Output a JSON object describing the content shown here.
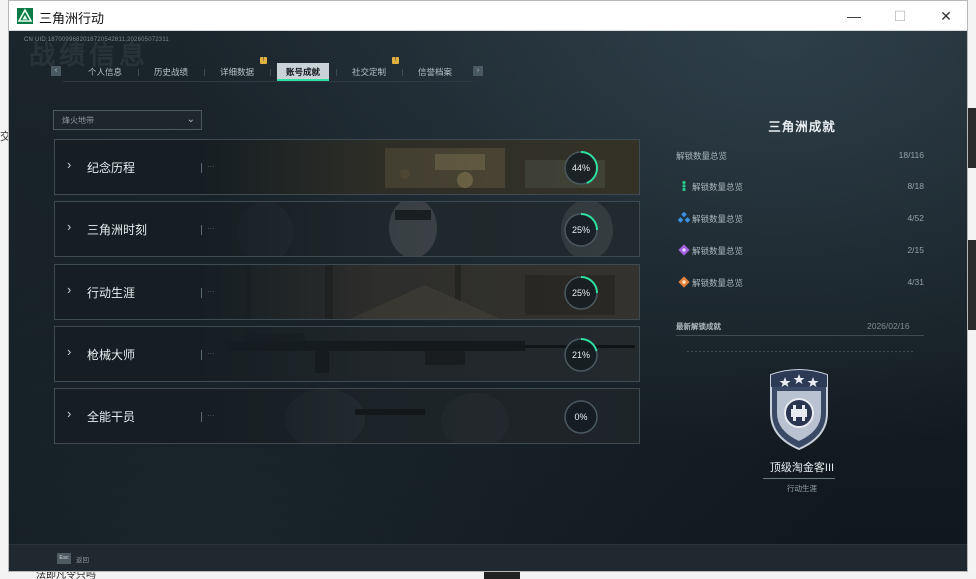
{
  "window": {
    "title": "三角洲行动",
    "controls": {
      "minimize": "—",
      "maximize": "☐",
      "close": "✕"
    }
  },
  "header": {
    "uid_line": "CN UID:1870099682018720542811,202605072311",
    "watermark": "战绩信息"
  },
  "nav": {
    "prev_arrow": "‹",
    "next_arrow": "›",
    "tabs": [
      {
        "label": "个人信息",
        "active": false,
        "badge": ""
      },
      {
        "label": "历史战绩",
        "active": false,
        "badge": ""
      },
      {
        "label": "详细数据",
        "active": false,
        "badge": "!"
      },
      {
        "label": "账号成就",
        "active": true,
        "badge": ""
      },
      {
        "label": "社交定制",
        "active": false,
        "badge": "!"
      },
      {
        "label": "信誉档案",
        "active": false,
        "badge": ""
      }
    ]
  },
  "filter": {
    "value": "烽火地带"
  },
  "categories": [
    {
      "label": "纪念历程",
      "progress": 44,
      "progress_text": "44%"
    },
    {
      "label": "三角洲时刻",
      "progress": 25,
      "progress_text": "25%"
    },
    {
      "label": "行动生涯",
      "progress": 25,
      "progress_text": "25%"
    },
    {
      "label": "枪械大师",
      "progress": 21,
      "progress_text": "21%"
    },
    {
      "label": "全能干员",
      "progress": 0,
      "progress_text": "0%"
    }
  ],
  "card_dots": "···",
  "right_panel": {
    "title": "三角洲成就",
    "total": {
      "label": "解锁数量总览",
      "value": "18/116"
    },
    "tiers": [
      {
        "icon": "green-dots-icon",
        "color": "#28c88a",
        "label": "解锁数量总览",
        "value": "8/18"
      },
      {
        "icon": "blue-diamond-icon",
        "color": "#3a8fe0",
        "label": "解锁数量总览",
        "value": "4/52"
      },
      {
        "icon": "purple-diamond-icon",
        "color": "#a060e0",
        "label": "解锁数量总览",
        "value": "2/15"
      },
      {
        "icon": "orange-diamond-icon",
        "color": "#e0803a",
        "label": "解锁数量总览",
        "value": "4/31"
      }
    ],
    "latest": {
      "label": "最新解锁成就",
      "date": "2026/02/16",
      "name": "顶级淘金客III",
      "category": "行动生涯"
    }
  },
  "footer": {
    "key": "Esc",
    "label": "返回"
  },
  "background_app": {
    "text": "法即凡令只吗"
  },
  "colors": {
    "accent": "#2ee0a0",
    "ring_track": "#4a5860",
    "panel_bg": "#151e24"
  }
}
